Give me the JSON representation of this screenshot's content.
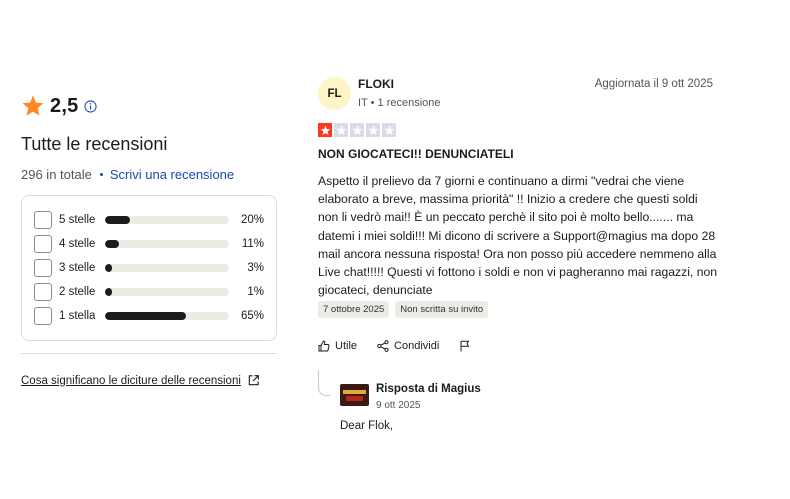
{
  "summary": {
    "rating": "2,5",
    "heading": "Tutte le recensioni",
    "total": "296 in totale",
    "write_link": "Scrivi una recensione",
    "distribution": [
      {
        "label": "5 stelle",
        "percent_text": "20%",
        "fraction": 0.2
      },
      {
        "label": "4 stelle",
        "percent_text": "11%",
        "fraction": 0.11
      },
      {
        "label": "3 stelle",
        "percent_text": "3%",
        "fraction": 0.03
      },
      {
        "label": "2 stelle",
        "percent_text": "1%",
        "fraction": 0.01
      },
      {
        "label": "1 stella",
        "percent_text": "65%",
        "fraction": 0.65
      }
    ],
    "meaning_link": "Cosa significano le diciture delle recensioni"
  },
  "review": {
    "avatar_initials": "FL",
    "author": "FLOKI",
    "meta": "IT • 1 recensione",
    "updated": "Aggiornata il 9 ott 2025",
    "stars": 1,
    "title": "NON GIOCATECI!! DENUNCIATELI",
    "body": "Aspetto il prelievo da 7 giorni e continuano a dirmi \"vedrai che viene elaborato a breve, massima priorità\" !! Inizio a credere che questi soldi non li vedrò mai!! È un peccato perchè il sito poi è molto bello....... ma datemi i miei soldi!!! Mi dicono di scrivere a Support@magius ma dopo 28 mail ancora nessuna risposta! Ora non posso più accedere nemmeno alla Live chat!!!!! Questi vi fottono i soldi e non vi pagheranno mai ragazzi, non giocateci, denunciate",
    "date_badge": "7 ottobre 2025",
    "invite_badge": "Non scritta su invito",
    "useful_label": "Utile",
    "share_label": "Condividi"
  },
  "reply": {
    "title": "Risposta di Magius",
    "date": "9 ott 2025",
    "text": "Dear Flok,"
  },
  "colors": {
    "star_orange": "#ff8622",
    "one_star_red": "#ff3722",
    "link_blue": "#1c48b6",
    "avatar_bg": "#fff4c6"
  }
}
